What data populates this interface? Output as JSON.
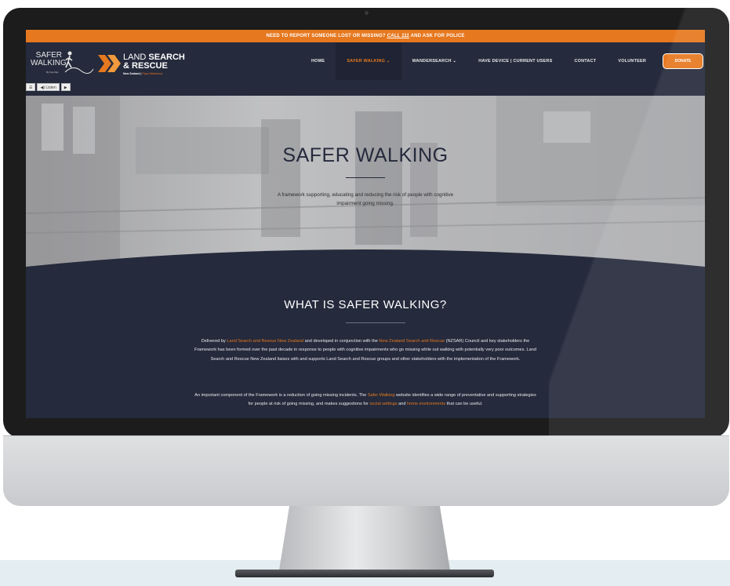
{
  "alert_bar": {
    "text_before": "NEED TO REPORT SOMEONE LOST OR MISSING?",
    "text_link": "CALL 111",
    "text_after": "AND ASK FOR POLICE"
  },
  "logos": {
    "safer_line1": "SAFER",
    "safer_line2": "WALKING",
    "safer_tagline": "By Kay Ray",
    "lsr_line1_light": "LAND",
    "lsr_line1_bold": "SEARCH",
    "lsr_line2": "& RESCUE",
    "lsr_line3": "New Zealand",
    "lsr_line3_maori": "Papa Taiwhenua"
  },
  "nav": {
    "items": [
      {
        "label": "HOME"
      },
      {
        "label": "SAFER WALKING ⌄"
      },
      {
        "label": "WANDERSEARCH ⌄"
      },
      {
        "label": "HAVE DEVICE | CURRENT USERS"
      },
      {
        "label": "CONTACT"
      },
      {
        "label": "VOLUNTEER"
      }
    ],
    "donate_label": "DONATE"
  },
  "listen_bar": {
    "menu_icon": "menu-icon",
    "listen_label": "◀) Listen",
    "play_label": "▶"
  },
  "hero": {
    "title": "SAFER WALKING",
    "subtitle": "A framework supporting, educating and reducing the risk of people with cognitive impairment going missing."
  },
  "content": {
    "title": "WHAT IS SAFER WALKING?",
    "p1_a": "Delivered by ",
    "p1_link1": "Land Search and Rescue New Zealand",
    "p1_b": " and developed in conjunction with the ",
    "p1_link2": "New Zealand Search and Rescue",
    "p1_c": " (NZSAR) Council and key stakeholders the Framework has been formed over the past decade in response to people with cognitive impairments who go missing while out walking with potentially very poor outcomes. Land Search and Rescue New Zealand liaises with and supports Land Search and Rescue groups and other stakeholders with the implementation of the Framework.",
    "p2_a": "An important component of the Framework is a reduction of going missing incidents. The ",
    "p2_link1": "Safer Walking",
    "p2_b": " website identifies a wide range of preventative and supporting strategies for people at risk of going missing, and makes suggestions for ",
    "p2_link2": "social settings",
    "p2_c": " and ",
    "p2_link3": "home environments",
    "p2_d": " that can be useful."
  },
  "colors": {
    "accent_orange": "#e6781f",
    "navy": "#252a3c"
  }
}
